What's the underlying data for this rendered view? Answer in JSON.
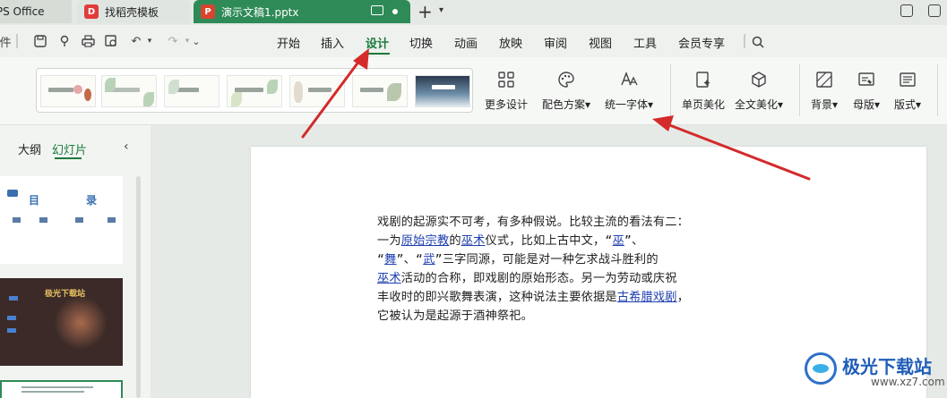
{
  "titlebar": {
    "wps_tab": "WPS Office",
    "template_tab": "找稻壳模板",
    "doc_tab": "演示文稿1.pptx",
    "new_tab": "+"
  },
  "quick_access": {
    "file": "件"
  },
  "menu": [
    "开始",
    "插入",
    "设计",
    "切换",
    "动画",
    "放映",
    "审阅",
    "视图",
    "工具",
    "会员专享"
  ],
  "active_menu": "设计",
  "ribbon": {
    "more_design": "更多设计",
    "color_scheme": "配色方案",
    "unify_font": "统一字体",
    "single_beautify": "单页美化",
    "full_beautify": "全文美化",
    "background": "背景",
    "master": "母版",
    "layout": "版式"
  },
  "left_pane": {
    "outline_tab": "大纲",
    "slides_tab": "幻灯片",
    "slide1_text_a": "目",
    "slide1_text_b": "录",
    "slide2_text": "极光下载站"
  },
  "slide_text": {
    "l1": "戏剧的起源实不可考，有多种假说。比较主流的看法有二：",
    "l2a": "一为",
    "l2link1": "原始宗教",
    "l2b": "的",
    "l2link2": "巫术",
    "l2c": "仪式，比如上古中文，“",
    "l2link3": "巫",
    "l2d": "”、",
    "l3a": "“",
    "l3link1": "舞",
    "l3b": "”、“",
    "l3link2": "武",
    "l3c": "”三字同源，可能是对一种乞求战斗胜利的",
    "l4link": "巫术",
    "l4a": "活动的合称，即戏剧的原始形态。另一为劳动或庆祝",
    "l5a": "丰收时的即兴歌舞表演，这种说法主要依据是",
    "l5link": "古希腊戏剧",
    "l5b": "，",
    "l6": "它被认为是起源于酒神祭祀。"
  },
  "watermark": {
    "name": "极光下载站",
    "url": "www.xz7.com"
  },
  "colors": {
    "accent": "#2e8b57",
    "arrow": "#d42a2a",
    "link": "#1f3fb0"
  }
}
